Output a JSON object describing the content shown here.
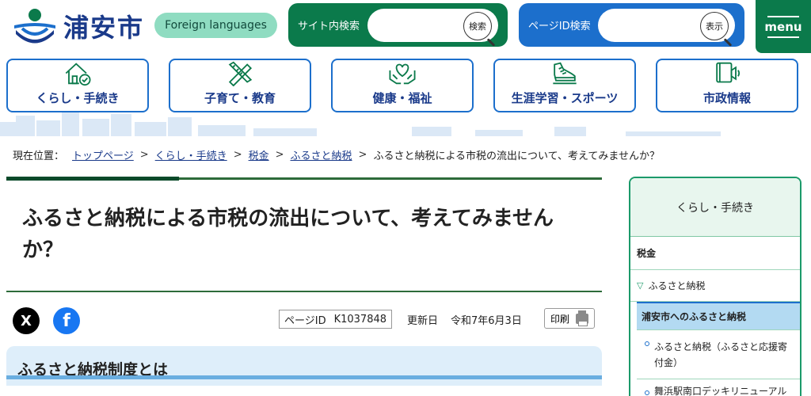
{
  "header": {
    "logo_text": "浦安市",
    "foreign_languages": "Foreign languages",
    "site_search": {
      "label": "サイト内検索",
      "button": "検索",
      "placeholder": ""
    },
    "id_search": {
      "label": "ページID検索",
      "button": "表示",
      "placeholder": ""
    },
    "menu_label": "menu"
  },
  "nav": {
    "items": [
      {
        "label": "くらし・手続き",
        "icon": "house-check-icon"
      },
      {
        "label": "子育て・教育",
        "icon": "pencil-ruler-icon"
      },
      {
        "label": "健康・福祉",
        "icon": "heart-hands-icon"
      },
      {
        "label": "生涯学習・スポーツ",
        "icon": "running-shoe-icon"
      },
      {
        "label": "市政情報",
        "icon": "megaphone-book-icon"
      }
    ]
  },
  "breadcrumb": {
    "current_position_label": "現在位置：",
    "links": [
      "トップページ",
      "くらし・手続き",
      "税金",
      "ふるさと納税"
    ],
    "current": "ふるさと納税による市税の流出について、考えてみませんか？"
  },
  "main": {
    "title": "ふるさと納税による市税の流出について、考えてみませんか？",
    "share": {
      "x": "X",
      "facebook": "f"
    },
    "page_id_label": "ページID",
    "page_id": "K1037848",
    "updated_label": "更新日",
    "updated_date": "令和7年6月3日",
    "print_label": "印刷",
    "section_heading": "ふるさと納税制度とは"
  },
  "sidebar": {
    "heading": "くらし・手続き",
    "tax": "税金",
    "furusato": "ふるさと納税",
    "current": "浦安市へのふるさと納税",
    "subitems": [
      "ふるさと納税（ふるさと応援寄付金）",
      "舞浜駅南口デッキリニューアル"
    ]
  },
  "colors": {
    "green": "#0b7a4b",
    "blue": "#1c6fcc",
    "navy": "#1a3a8a",
    "mint": "#8fdcc1"
  }
}
